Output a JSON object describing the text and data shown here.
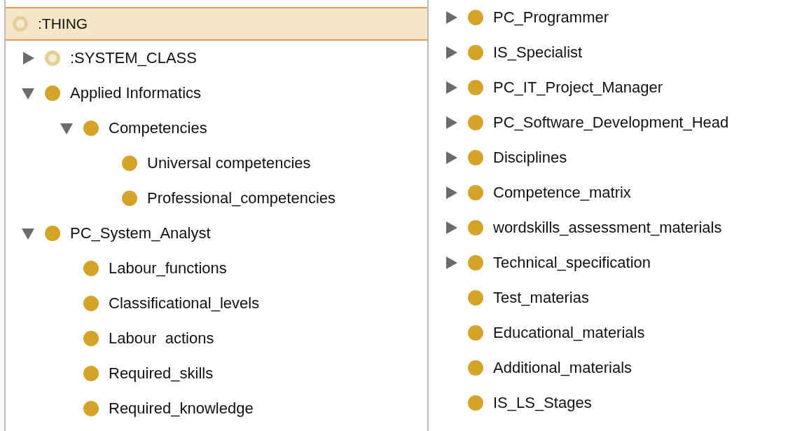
{
  "root": {
    "label": ":THING",
    "system": true,
    "selected": true
  },
  "columns": [
    [
      {
        "label": ":SYSTEM_CLASS",
        "kind": "branch",
        "expanded": false,
        "system": true,
        "selected": false
      },
      {
        "label": "Applied Informatics",
        "kind": "branch",
        "expanded": true,
        "system": false,
        "selected": false,
        "children": [
          {
            "label": "Competencies",
            "kind": "branch",
            "expanded": true,
            "system": false,
            "selected": false,
            "children": [
              {
                "label": "Universal competencies",
                "kind": "leaf",
                "system": false,
                "selected": false
              },
              {
                "label": "Professional_competencies",
                "kind": "leaf",
                "system": false,
                "selected": false
              }
            ]
          }
        ]
      },
      {
        "label": "PC_System_Analyst",
        "kind": "branch",
        "expanded": true,
        "system": false,
        "selected": false,
        "children": [
          {
            "label": "Labour_functions",
            "kind": "leaf",
            "system": false,
            "selected": false
          },
          {
            "label": "Classificational_levels",
            "kind": "leaf",
            "system": false,
            "selected": false
          },
          {
            "label": "Labour  actions",
            "kind": "leaf",
            "system": false,
            "selected": false
          },
          {
            "label": "Required_skills",
            "kind": "leaf",
            "system": false,
            "selected": false
          },
          {
            "label": "Required_knowledge",
            "kind": "leaf",
            "system": false,
            "selected": false
          }
        ]
      }
    ],
    [
      {
        "label": "PC_Programmer",
        "kind": "branch",
        "expanded": false,
        "system": false,
        "selected": false
      },
      {
        "label": "IS_Specialist",
        "kind": "branch",
        "expanded": false,
        "system": false,
        "selected": false
      },
      {
        "label": "PC_IT_Project_Manager",
        "kind": "branch",
        "expanded": false,
        "system": false,
        "selected": false
      },
      {
        "label": "PC_Software_Development_Head",
        "kind": "branch",
        "expanded": false,
        "system": false,
        "selected": false
      },
      {
        "label": "Disciplines",
        "kind": "branch",
        "expanded": false,
        "system": false,
        "selected": false
      },
      {
        "label": "Competence_matrix",
        "kind": "branch",
        "expanded": false,
        "system": false,
        "selected": false
      },
      {
        "label": "wordskills_assessment_materials",
        "kind": "branch",
        "expanded": false,
        "system": false,
        "selected": false
      },
      {
        "label": "Technical_specification",
        "kind": "branch",
        "expanded": false,
        "system": false,
        "selected": false
      },
      {
        "label": "Test_materias",
        "kind": "leaf",
        "system": false,
        "selected": false
      },
      {
        "label": "Educational_materials",
        "kind": "leaf",
        "system": false,
        "selected": false
      },
      {
        "label": "Additional_materials",
        "kind": "leaf",
        "system": false,
        "selected": false
      },
      {
        "label": "IS_LS_Stages",
        "kind": "leaf",
        "system": false,
        "selected": false
      }
    ]
  ]
}
